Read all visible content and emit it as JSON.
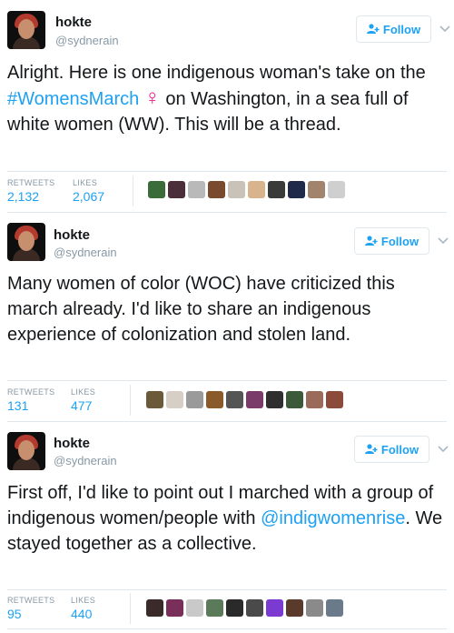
{
  "follow_label": "Follow",
  "tweets": [
    {
      "name": "hokte",
      "handle": "@sydnerain",
      "text_parts": {
        "a": "Alright. Here is one indigenous woman's take on the ",
        "hashtag": "#WomensMarch",
        "venus": "♀",
        "b": " on Washington, in a sea full of white women (WW). This will be a thread."
      },
      "retweets_label": "RETWEETS",
      "retweets": "2,132",
      "likes_label": "LIKES",
      "likes": "2,067",
      "liker_colors": [
        "#3c6b3a",
        "#4a2e3a",
        "#b9b9b9",
        "#7a4a2f",
        "#c9c2b8",
        "#d9b38b",
        "#3a3a3a",
        "#1f2a4a",
        "#a2836c",
        "#cfcfcf"
      ]
    },
    {
      "name": "hokte",
      "handle": "@sydnerain",
      "text": "Many women of color (WOC) have criticized this march already. I'd like to share an indigenous experience of colonization and stolen land.",
      "retweets_label": "RETWEETS",
      "retweets": "131",
      "likes_label": "LIKES",
      "likes": "477",
      "liker_colors": [
        "#6b5a3a",
        "#d7cfc6",
        "#9a9a9a",
        "#8a5a2a",
        "#555555",
        "#7a3b6b",
        "#2f2f2f",
        "#3a5a3a",
        "#9a6a5a",
        "#8b4a3a"
      ]
    },
    {
      "name": "hokte",
      "handle": "@sydnerain",
      "text_parts": {
        "a": "First off, I'd like to point out I marched with a group of indigenous women/people with ",
        "mention": "@indigwomenrise",
        "b": ". We stayed together as a collective."
      },
      "retweets_label": "RETWEETS",
      "retweets": "95",
      "likes_label": "LIKES",
      "likes": "440",
      "liker_colors": [
        "#3a2a2a",
        "#7a2f5a",
        "#c9c9c9",
        "#5a7a5a",
        "#2a2a2a",
        "#4a4a4a",
        "#7b3bd0",
        "#5a3a2a",
        "#8a8a8a",
        "#6a7a8a"
      ]
    }
  ]
}
